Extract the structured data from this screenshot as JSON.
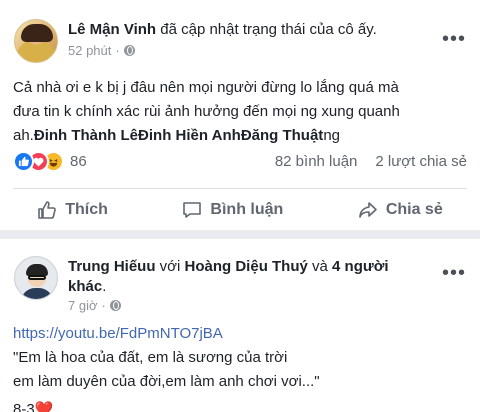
{
  "post1": {
    "author": "Lê Mận Vinh",
    "action": "đã cập nhật trạng thái của cô ấy.",
    "time": "52 phút",
    "text_line1": "Cả nhà ơi e k bị j đâu nên mọi người đừng lo lắng quá mà",
    "text_line2": "đưa tin k chính xác rùi ảnh hưởng đến mọi ng xung quanh",
    "text_line3_prefix": "ah.",
    "mentions": [
      "Đinh Thành Lê",
      "Đinh Hiền Anh",
      "Đăng Thuật"
    ],
    "text_line3_suffix": "ng",
    "reaction_count": "86",
    "comments": "82 bình luận",
    "shares": "2 lượt chia sẻ",
    "like_label": "Thích",
    "comment_label": "Bình luận",
    "share_label": "Chia sẻ",
    "more": "•••",
    "icons": [
      "globe-icon",
      "like-reaction-icon",
      "love-reaction-icon",
      "haha-reaction-icon",
      "thumbs-up-icon",
      "comment-icon",
      "share-icon",
      "more-options-icon"
    ]
  },
  "post2": {
    "author": "Trung Hiếuu",
    "with": "với",
    "tagged": "Hoàng Diệu Thuý",
    "and": "và",
    "others_line1": "4 người",
    "others_line2": "khác",
    "period": ".",
    "time": "7 giờ",
    "link": "https://youtu.be/FdPmNTO7jBA",
    "quote1": "\"Em là hoa của đất, em là sương của trời",
    "quote2": "em làm duyên của đời,em làm anh chơi vơi...\"",
    "date": "8-3",
    "heart": "❤️",
    "more": "•••"
  },
  "colors": {
    "link": "#4267b2",
    "like": "#1877f2",
    "love": "#f33e58",
    "haha": "#f7b928",
    "muted": "#606770"
  }
}
